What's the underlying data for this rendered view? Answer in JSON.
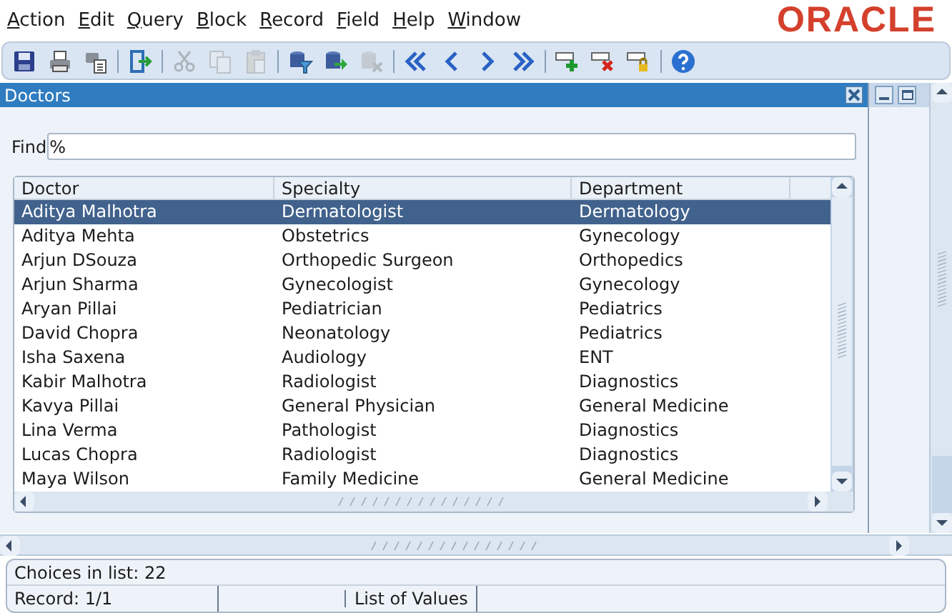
{
  "menu": [
    {
      "label": "Action"
    },
    {
      "label": "Edit"
    },
    {
      "label": "Query"
    },
    {
      "label": "Block"
    },
    {
      "label": "Record"
    },
    {
      "label": "Field"
    },
    {
      "label": "Help"
    },
    {
      "label": "Window"
    }
  ],
  "logo": "ORACLE",
  "toolbar": [
    [
      {
        "kind": "save",
        "disabled": false
      },
      {
        "kind": "print",
        "disabled": false
      },
      {
        "kind": "print-setup",
        "disabled": false
      }
    ],
    [
      {
        "kind": "exit",
        "disabled": false
      }
    ],
    [
      {
        "kind": "cut",
        "disabled": true
      },
      {
        "kind": "copy",
        "disabled": true
      },
      {
        "kind": "paste",
        "disabled": true
      }
    ],
    [
      {
        "kind": "enter-query",
        "disabled": false
      },
      {
        "kind": "execute-query",
        "disabled": false
      },
      {
        "kind": "cancel-query",
        "disabled": true
      }
    ],
    [
      {
        "kind": "first",
        "disabled": false
      },
      {
        "kind": "previous",
        "disabled": false
      },
      {
        "kind": "next",
        "disabled": false
      },
      {
        "kind": "last",
        "disabled": false
      }
    ],
    [
      {
        "kind": "insert",
        "disabled": false
      },
      {
        "kind": "delete",
        "disabled": false
      },
      {
        "kind": "lock",
        "disabled": false
      }
    ],
    [
      {
        "kind": "help",
        "disabled": false
      }
    ]
  ],
  "window": {
    "title": "Doctors"
  },
  "find": {
    "label": "Find",
    "value": "%"
  },
  "table": {
    "columns": [
      "Doctor",
      "Specialty",
      "Department"
    ],
    "rows": [
      {
        "cells": [
          "Aditya Malhotra",
          "Dermatologist",
          "Dermatology"
        ],
        "selected": true
      },
      {
        "cells": [
          "Aditya Mehta",
          "Obstetrics",
          "Gynecology"
        ],
        "selected": false
      },
      {
        "cells": [
          "Arjun DSouza",
          "Orthopedic Surgeon",
          "Orthopedics"
        ],
        "selected": false
      },
      {
        "cells": [
          "Arjun Sharma",
          "Gynecologist",
          "Gynecology"
        ],
        "selected": false
      },
      {
        "cells": [
          "Aryan Pillai",
          "Pediatrician",
          "Pediatrics"
        ],
        "selected": false
      },
      {
        "cells": [
          "David Chopra",
          "Neonatology",
          "Pediatrics"
        ],
        "selected": false
      },
      {
        "cells": [
          "Isha Saxena",
          "Audiology",
          "ENT"
        ],
        "selected": false
      },
      {
        "cells": [
          "Kabir Malhotra",
          "Radiologist",
          "Diagnostics"
        ],
        "selected": false
      },
      {
        "cells": [
          "Kavya Pillai",
          "General Physician",
          "General Medicine"
        ],
        "selected": false
      },
      {
        "cells": [
          "Lina Verma",
          "Pathologist",
          "Diagnostics"
        ],
        "selected": false
      },
      {
        "cells": [
          "Lucas Chopra",
          "Radiologist",
          "Diagnostics"
        ],
        "selected": false
      },
      {
        "cells": [
          "Maya Wilson",
          "Family Medicine",
          "General Medicine"
        ],
        "selected": false
      }
    ]
  },
  "message": "Choices in list: 22",
  "status_bar": {
    "record": "Record: 1/1",
    "mode": "List of Values"
  }
}
